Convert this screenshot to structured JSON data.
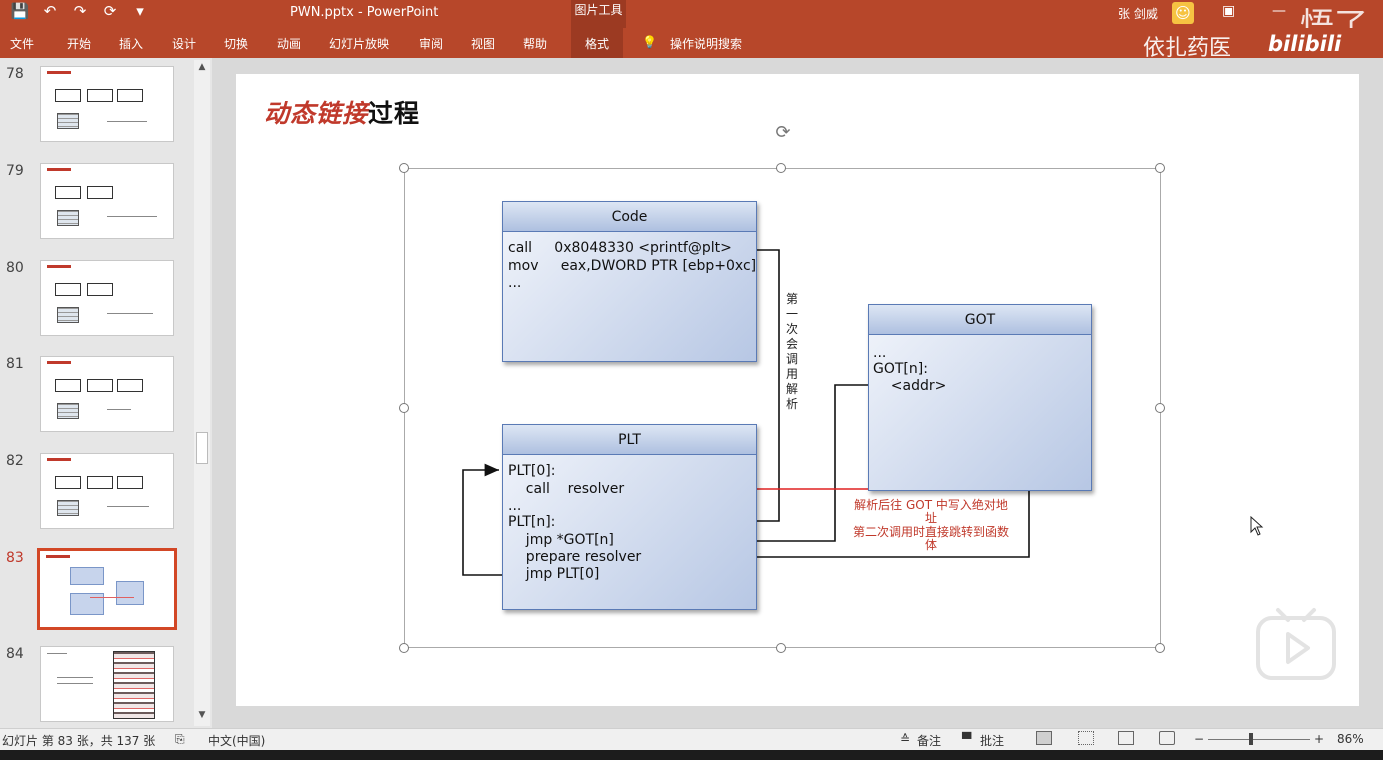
{
  "app": {
    "doc_title": "PWN.pptx - PowerPoint",
    "context_tools": "图片工具",
    "user_name": "张 剑威",
    "quick_access": [
      "💾",
      "↶",
      "↷",
      "⟳",
      "▾"
    ]
  },
  "watermark": {
    "channel": "依扎药医",
    "site": "bilibili",
    "corner": "悟了"
  },
  "ribbon": {
    "tabs": [
      "文件",
      "开始",
      "插入",
      "设计",
      "切换",
      "动画",
      "幻灯片放映",
      "审阅",
      "视图",
      "帮助",
      "格式"
    ],
    "active_tab": "格式",
    "search": "操作说明搜索"
  },
  "thumbnails": {
    "numbers": [
      "78",
      "79",
      "80",
      "81",
      "82",
      "83",
      "84"
    ],
    "active": "83"
  },
  "slide": {
    "title_red": "动态链接",
    "title_black": "过程",
    "code_box": {
      "header": "Code",
      "lines": [
        "call     0x8048330 <printf@plt>",
        "mov     eax,DWORD PTR [ebp+0xc]",
        "..."
      ]
    },
    "plt_box": {
      "header": "PLT",
      "lines": [
        "PLT[0]:",
        "    call    resolver",
        "...",
        "PLT[n]:",
        "    jmp *GOT[n]",
        "    prepare resolver",
        "    jmp PLT[0]"
      ]
    },
    "got_box": {
      "header": "GOT",
      "lines": [
        "...",
        "GOT[n]:",
        "    <addr>"
      ]
    },
    "vertical_note": "第一次会调用解析",
    "red_note_1": "解析后往 GOT 中写入绝对地址",
    "red_note_2": "第二次调用时直接跳转到函数体"
  },
  "status": {
    "slide_info": "幻灯片 第 83 张，共 137 张",
    "language": "中文(中国)",
    "notes": "备注",
    "comments": "批注",
    "zoom": "86%",
    "zoom_minus": "−",
    "zoom_plus": "+"
  },
  "colors": {
    "ribbon": "#b7472a",
    "accent_red": "#c0392b",
    "box_fill": "#b7c7e4",
    "active_thumb_border": "#d24726"
  }
}
